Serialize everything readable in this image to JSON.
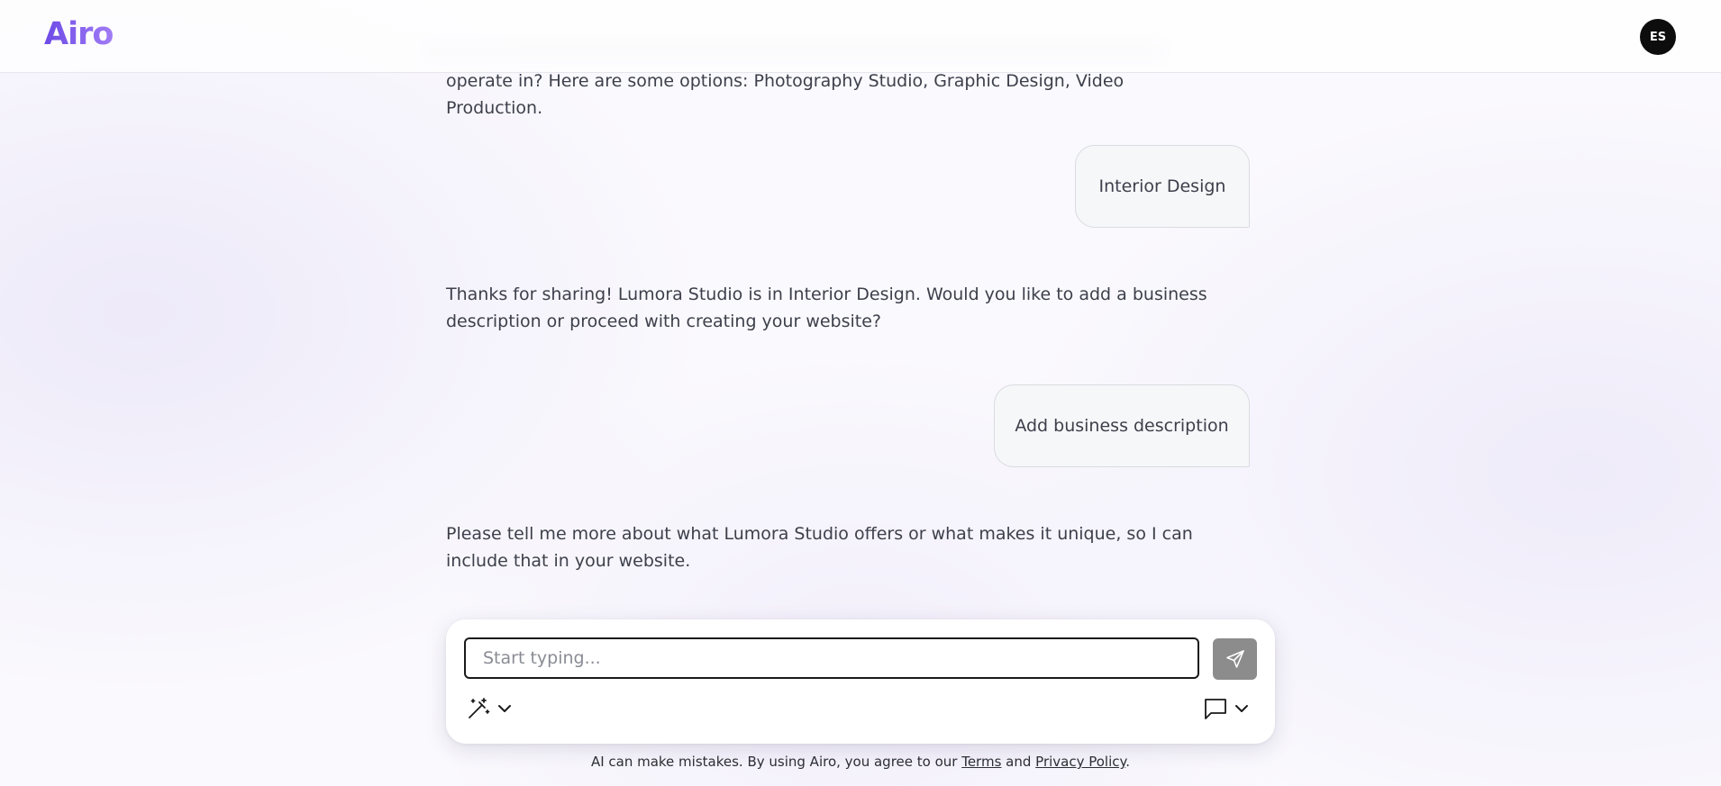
{
  "header": {
    "logo": "Airo",
    "avatar_initials": "ES"
  },
  "chat": {
    "messages": [
      {
        "role": "assistant",
        "text": "operate in? Here are some options: Photography Studio, Graphic Design, Video Production."
      },
      {
        "role": "user",
        "text": "Interior Design"
      },
      {
        "role": "assistant",
        "text": "Thanks for sharing! Lumora Studio is in Interior Design. Would you like to add a business description or proceed with creating your website?"
      },
      {
        "role": "user",
        "text": "Add business description"
      },
      {
        "role": "assistant",
        "text": "Please tell me more about what Lumora Studio offers or what makes it unique, so I can include that in your website."
      }
    ]
  },
  "composer": {
    "placeholder": "Start typing...",
    "left_tool_icon": "magic-wand-icon",
    "right_tool_icon": "chat-bubble-icon"
  },
  "footer": {
    "text_before": "AI can make mistakes. By using Airo, you agree to our ",
    "terms_label": "Terms",
    "middle": " and ",
    "privacy_label": "Privacy Policy",
    "text_after": "."
  },
  "colors": {
    "brand": "#8b5cf6",
    "avatar_bg": "#0d0d0d",
    "send_button": "#8c8c8c",
    "bubble_bg": "#f6f7f9"
  }
}
